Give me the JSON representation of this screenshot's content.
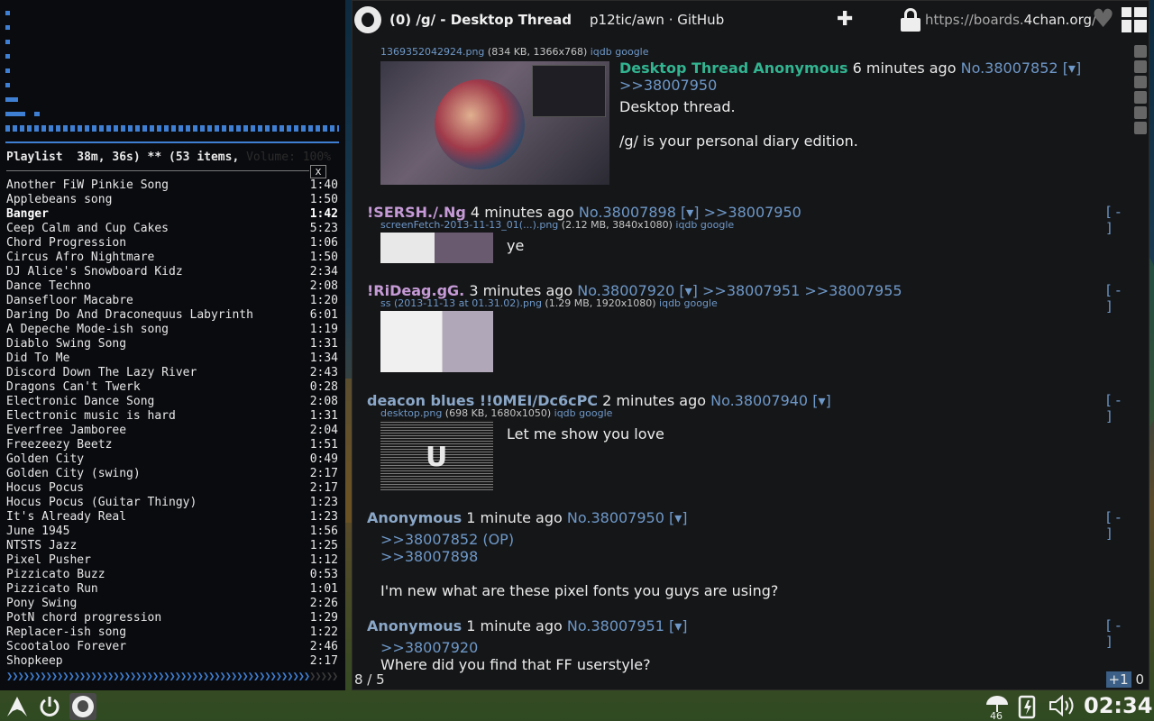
{
  "playlist": {
    "header": "Playlist  38m, 36s) ** (53 items,",
    "volume": " Volume: 100%",
    "close_label": "x",
    "items": [
      {
        "title": "Another FiW Pinkie Song",
        "time": "1:40"
      },
      {
        "title": "Applebeans song",
        "time": "1:50"
      },
      {
        "title": "Banger",
        "time": "1:42",
        "current": true
      },
      {
        "title": "Ceep Calm and Cup Cakes",
        "time": "5:23"
      },
      {
        "title": "Chord Progression",
        "time": "1:06"
      },
      {
        "title": "Circus Afro Nightmare",
        "time": "1:50"
      },
      {
        "title": "DJ Alice's Snowboard Kidz",
        "time": "2:34"
      },
      {
        "title": "Dance Techno",
        "time": "2:08"
      },
      {
        "title": "Dansefloor Macabre",
        "time": "1:20"
      },
      {
        "title": "Daring Do And Draconequus Labyrinth",
        "time": "6:01"
      },
      {
        "title": "A Depeche Mode-ish song",
        "time": "1:19"
      },
      {
        "title": "Diablo Swing Song",
        "time": "1:31"
      },
      {
        "title": "Did To Me",
        "time": "1:34"
      },
      {
        "title": "Discord Down The Lazy River",
        "time": "2:43"
      },
      {
        "title": "Dragons Can't Twerk",
        "time": "0:28"
      },
      {
        "title": "Electronic Dance Song",
        "time": "2:08"
      },
      {
        "title": "Electronic music is hard",
        "time": "1:31"
      },
      {
        "title": "Everfree Jamboree",
        "time": "2:04"
      },
      {
        "title": "Freezeezy Beetz",
        "time": "1:51"
      },
      {
        "title": "Golden City",
        "time": "0:49"
      },
      {
        "title": "Golden City (swing)",
        "time": "2:17"
      },
      {
        "title": "Hocus Pocus",
        "time": "2:17"
      },
      {
        "title": "Hocus Pocus (Guitar Thingy)",
        "time": "1:23"
      },
      {
        "title": "It's Already Real",
        "time": "1:23"
      },
      {
        "title": "June 1945",
        "time": "1:56"
      },
      {
        "title": "NTSTS Jazz",
        "time": "1:25"
      },
      {
        "title": "Pixel Pusher",
        "time": "1:12"
      },
      {
        "title": "Pizzicato Buzz",
        "time": "0:53"
      },
      {
        "title": "Pizzicato Run",
        "time": "1:01"
      },
      {
        "title": "Pony Swing",
        "time": "2:26"
      },
      {
        "title": "PotN chord progression",
        "time": "1:29"
      },
      {
        "title": "Replacer-ish song",
        "time": "1:22"
      },
      {
        "title": "Scootaloo Forever",
        "time": "2:46"
      },
      {
        "title": "Shopkeep",
        "time": "2:17"
      }
    ],
    "progress": 0.87
  },
  "browser": {
    "tab_title": "(0) /g/ - Desktop Thread",
    "tab_other": "p12tic/awn · GitHub",
    "url_prefix": "https://boards.",
    "url_domain": "4chan.org",
    "url_suffix": "/g",
    "status_left": "8 / 5",
    "status_plus": "+1",
    "status_zero": "0"
  },
  "posts": {
    "op": {
      "file_link": "1369352042924.png",
      "file_meta": " (834 KB, 1366x768) ",
      "file_tools": "iqdb google",
      "subject": "Desktop Thread",
      "name": "Anonymous",
      "age": "6 minutes ago",
      "no": "No.38007852",
      "menu": "[▾]",
      "reply_link": ">>38007950",
      "text1": "Desktop thread.",
      "text2": "/g/ is your personal diary edition."
    },
    "p1": {
      "name": "!SERSH./.Ng",
      "age": "4 minutes ago",
      "no": "No.38007898",
      "menu": "[▾]",
      "replies": ">>38007950",
      "hide": "[ - ]",
      "file_link": "screenFetch-2013-11-13_01(...).png",
      "file_meta": " (2.12 MB, 3840x1080) ",
      "file_tools": "iqdb google",
      "text": "ye"
    },
    "p2": {
      "name": "!RiDeag.gG.",
      "age": "3 minutes ago",
      "no": "No.38007920",
      "menu": "[▾]",
      "replies": ">>38007951 >>38007955",
      "hide": "[ - ]",
      "file_link": "ss (2013-11-13 at 01.31.02).png",
      "file_meta": " (1.29 MB, 1920x1080) ",
      "file_tools": "iqdb google"
    },
    "p3": {
      "name": "deacon blues !!0MEI/Dc6cPC",
      "age": "2 minutes ago",
      "no": "No.38007940",
      "menu": "[▾]",
      "hide": "[ - ]",
      "file_link": "desktop.png",
      "file_meta": " (698 KB, 1680x1050) ",
      "file_tools": "iqdb google",
      "text": "Let me show you love"
    },
    "p4": {
      "name": "Anonymous",
      "age": "1 minute ago",
      "no": "No.38007950",
      "menu": "[▾]",
      "hide": "[ - ]",
      "quote1": ">>38007852 (OP)",
      "quote2": ">>38007898",
      "text": "I'm new what are these pixel fonts you guys are using?"
    },
    "p5": {
      "name": "Anonymous",
      "age": "1 minute ago",
      "no": "No.38007951",
      "menu": "[▾]",
      "hide": "[ - ]",
      "quote1": ">>38007920",
      "text": "Where did you find that FF userstyle?"
    }
  },
  "panel": {
    "updates_count": "46",
    "clock": "02:34"
  }
}
